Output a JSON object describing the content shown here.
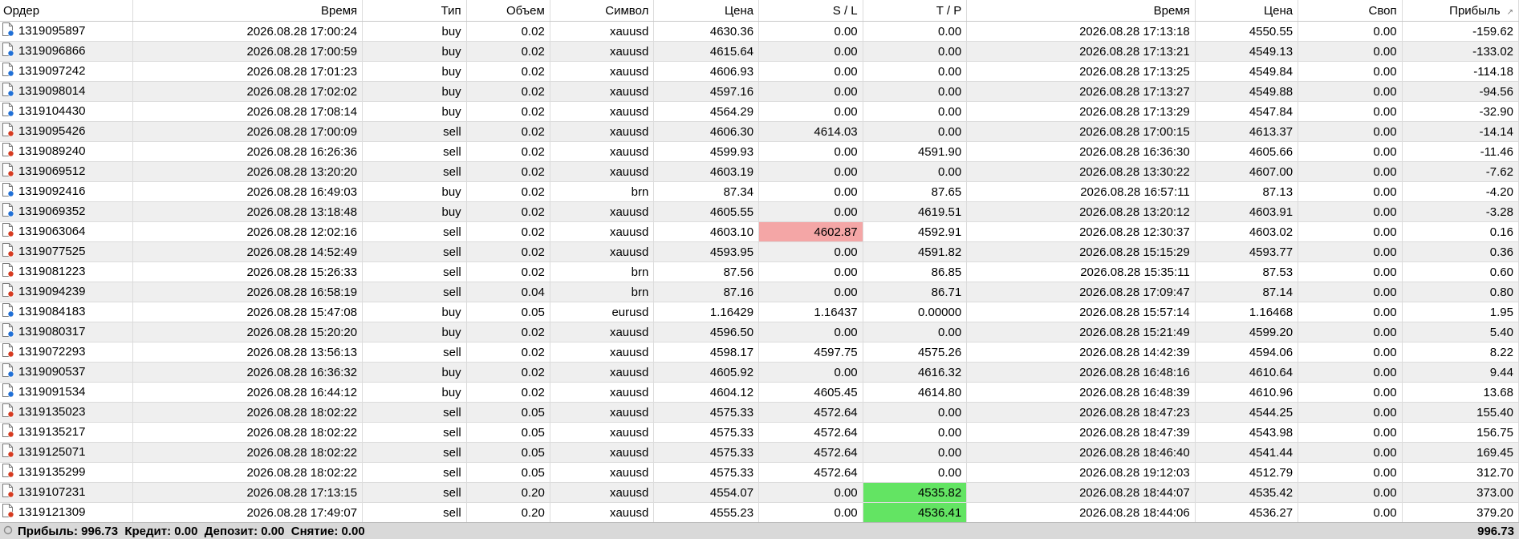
{
  "columns": [
    "Ордер",
    "Время",
    "Тип",
    "Объем",
    "Символ",
    "Цена",
    "S / L",
    "T / P",
    "Время",
    "Цена",
    "Своп",
    "Прибыль"
  ],
  "sort_indicator": "↗",
  "rows": [
    {
      "cells": [
        "1319095897",
        "2026.08.28 17:00:24",
        "buy",
        "0.02",
        "xauusd",
        "4630.36",
        "0.00",
        "0.00",
        "2026.08.28 17:13:18",
        "4550.55",
        "0.00",
        "-159.62"
      ],
      "side": "buy"
    },
    {
      "cells": [
        "1319096866",
        "2026.08.28 17:00:59",
        "buy",
        "0.02",
        "xauusd",
        "4615.64",
        "0.00",
        "0.00",
        "2026.08.28 17:13:21",
        "4549.13",
        "0.00",
        "-133.02"
      ],
      "side": "buy"
    },
    {
      "cells": [
        "1319097242",
        "2026.08.28 17:01:23",
        "buy",
        "0.02",
        "xauusd",
        "4606.93",
        "0.00",
        "0.00",
        "2026.08.28 17:13:25",
        "4549.84",
        "0.00",
        "-114.18"
      ],
      "side": "buy"
    },
    {
      "cells": [
        "1319098014",
        "2026.08.28 17:02:02",
        "buy",
        "0.02",
        "xauusd",
        "4597.16",
        "0.00",
        "0.00",
        "2026.08.28 17:13:27",
        "4549.88",
        "0.00",
        "-94.56"
      ],
      "side": "buy"
    },
    {
      "cells": [
        "1319104430",
        "2026.08.28 17:08:14",
        "buy",
        "0.02",
        "xauusd",
        "4564.29",
        "0.00",
        "0.00",
        "2026.08.28 17:13:29",
        "4547.84",
        "0.00",
        "-32.90"
      ],
      "side": "buy"
    },
    {
      "cells": [
        "1319095426",
        "2026.08.28 17:00:09",
        "sell",
        "0.02",
        "xauusd",
        "4606.30",
        "4614.03",
        "0.00",
        "2026.08.28 17:00:15",
        "4613.37",
        "0.00",
        "-14.14"
      ],
      "side": "sell"
    },
    {
      "cells": [
        "1319089240",
        "2026.08.28 16:26:36",
        "sell",
        "0.02",
        "xauusd",
        "4599.93",
        "0.00",
        "4591.90",
        "2026.08.28 16:36:30",
        "4605.66",
        "0.00",
        "-11.46"
      ],
      "side": "sell"
    },
    {
      "cells": [
        "1319069512",
        "2026.08.28 13:20:20",
        "sell",
        "0.02",
        "xauusd",
        "4603.19",
        "0.00",
        "0.00",
        "2026.08.28 13:30:22",
        "4607.00",
        "0.00",
        "-7.62"
      ],
      "side": "sell"
    },
    {
      "cells": [
        "1319092416",
        "2026.08.28 16:49:03",
        "buy",
        "0.02",
        "brn",
        "87.34",
        "0.00",
        "87.65",
        "2026.08.28 16:57:11",
        "87.13",
        "0.00",
        "-4.20"
      ],
      "side": "buy"
    },
    {
      "cells": [
        "1319069352",
        "2026.08.28 13:18:48",
        "buy",
        "0.02",
        "xauusd",
        "4605.55",
        "0.00",
        "4619.51",
        "2026.08.28 13:20:12",
        "4603.91",
        "0.00",
        "-3.28"
      ],
      "side": "buy"
    },
    {
      "cells": [
        "1319063064",
        "2026.08.28 12:02:16",
        "sell",
        "0.02",
        "xauusd",
        "4603.10",
        "4602.87",
        "4592.91",
        "2026.08.28 12:30:37",
        "4603.02",
        "0.00",
        "0.16"
      ],
      "side": "sell",
      "sl_hit": true
    },
    {
      "cells": [
        "1319077525",
        "2026.08.28 14:52:49",
        "sell",
        "0.02",
        "xauusd",
        "4593.95",
        "0.00",
        "4591.82",
        "2026.08.28 15:15:29",
        "4593.77",
        "0.00",
        "0.36"
      ],
      "side": "sell"
    },
    {
      "cells": [
        "1319081223",
        "2026.08.28 15:26:33",
        "sell",
        "0.02",
        "brn",
        "87.56",
        "0.00",
        "86.85",
        "2026.08.28 15:35:11",
        "87.53",
        "0.00",
        "0.60"
      ],
      "side": "sell"
    },
    {
      "cells": [
        "1319094239",
        "2026.08.28 16:58:19",
        "sell",
        "0.04",
        "brn",
        "87.16",
        "0.00",
        "86.71",
        "2026.08.28 17:09:47",
        "87.14",
        "0.00",
        "0.80"
      ],
      "side": "sell"
    },
    {
      "cells": [
        "1319084183",
        "2026.08.28 15:47:08",
        "buy",
        "0.05",
        "eurusd",
        "1.16429",
        "1.16437",
        "0.00000",
        "2026.08.28 15:57:14",
        "1.16468",
        "0.00",
        "1.95"
      ],
      "side": "buy"
    },
    {
      "cells": [
        "1319080317",
        "2026.08.28 15:20:20",
        "buy",
        "0.02",
        "xauusd",
        "4596.50",
        "0.00",
        "0.00",
        "2026.08.28 15:21:49",
        "4599.20",
        "0.00",
        "5.40"
      ],
      "side": "buy"
    },
    {
      "cells": [
        "1319072293",
        "2026.08.28 13:56:13",
        "sell",
        "0.02",
        "xauusd",
        "4598.17",
        "4597.75",
        "4575.26",
        "2026.08.28 14:42:39",
        "4594.06",
        "0.00",
        "8.22"
      ],
      "side": "sell"
    },
    {
      "cells": [
        "1319090537",
        "2026.08.28 16:36:32",
        "buy",
        "0.02",
        "xauusd",
        "4605.92",
        "0.00",
        "4616.32",
        "2026.08.28 16:48:16",
        "4610.64",
        "0.00",
        "9.44"
      ],
      "side": "buy"
    },
    {
      "cells": [
        "1319091534",
        "2026.08.28 16:44:12",
        "buy",
        "0.02",
        "xauusd",
        "4604.12",
        "4605.45",
        "4614.80",
        "2026.08.28 16:48:39",
        "4610.96",
        "0.00",
        "13.68"
      ],
      "side": "buy"
    },
    {
      "cells": [
        "1319135023",
        "2026.08.28 18:02:22",
        "sell",
        "0.05",
        "xauusd",
        "4575.33",
        "4572.64",
        "0.00",
        "2026.08.28 18:47:23",
        "4544.25",
        "0.00",
        "155.40"
      ],
      "side": "sell"
    },
    {
      "cells": [
        "1319135217",
        "2026.08.28 18:02:22",
        "sell",
        "0.05",
        "xauusd",
        "4575.33",
        "4572.64",
        "0.00",
        "2026.08.28 18:47:39",
        "4543.98",
        "0.00",
        "156.75"
      ],
      "side": "sell"
    },
    {
      "cells": [
        "1319125071",
        "2026.08.28 18:02:22",
        "sell",
        "0.05",
        "xauusd",
        "4575.33",
        "4572.64",
        "0.00",
        "2026.08.28 18:46:40",
        "4541.44",
        "0.00",
        "169.45"
      ],
      "side": "sell"
    },
    {
      "cells": [
        "1319135299",
        "2026.08.28 18:02:22",
        "sell",
        "0.05",
        "xauusd",
        "4575.33",
        "4572.64",
        "0.00",
        "2026.08.28 19:12:03",
        "4512.79",
        "0.00",
        "312.70"
      ],
      "side": "sell"
    },
    {
      "cells": [
        "1319107231",
        "2026.08.28 17:13:15",
        "sell",
        "0.20",
        "xauusd",
        "4554.07",
        "0.00",
        "4535.82",
        "2026.08.28 18:44:07",
        "4535.42",
        "0.00",
        "373.00"
      ],
      "side": "sell",
      "tp_hit": true
    },
    {
      "cells": [
        "1319121309",
        "2026.08.28 17:49:07",
        "sell",
        "0.20",
        "xauusd",
        "4555.23",
        "0.00",
        "4536.41",
        "2026.08.28 18:44:06",
        "4536.27",
        "0.00",
        "379.20"
      ],
      "side": "sell",
      "tp_hit": true
    }
  ],
  "footer": {
    "summary": "Прибыль: 996.73  Кредит: 0.00  Депозит: 0.00  Снятие: 0.00",
    "total": "996.73"
  },
  "colors": {
    "buy_badge": "#1f6fd6",
    "sell_badge": "#d63a1f",
    "sl_highlight": "#f4a6a6",
    "tp_highlight": "#63e463",
    "row_alt": "#efefef"
  }
}
